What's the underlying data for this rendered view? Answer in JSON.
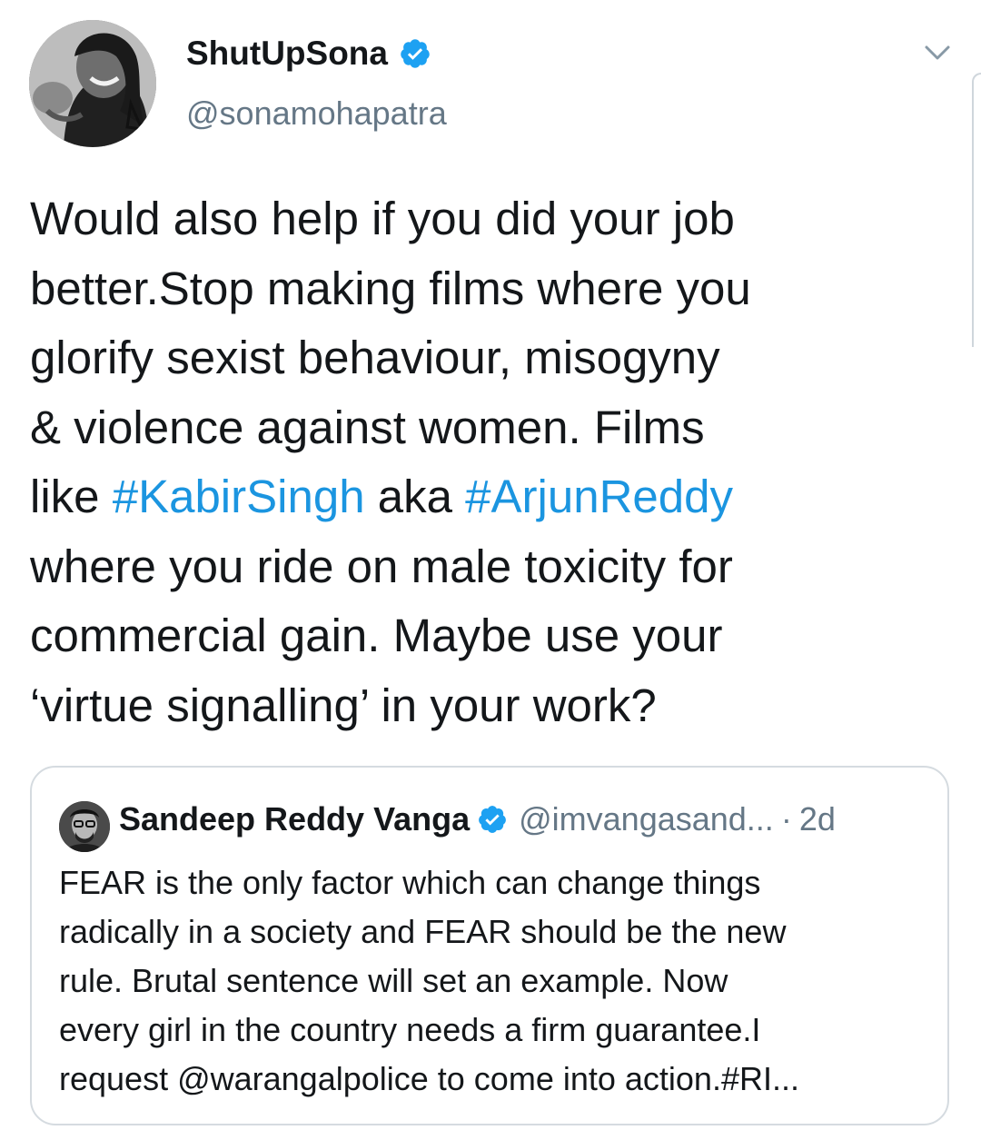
{
  "tweet": {
    "display_name": "ShutUpSona",
    "handle": "@sonamohapatra",
    "verified_icon": "verified-badge-icon",
    "menu_icon": "chevron-down-icon",
    "lines": [
      [
        {
          "text": "Would also help if you did your job",
          "hashtag": false
        }
      ],
      [
        {
          "text": "better.Stop making films where you",
          "hashtag": false
        }
      ],
      [
        {
          "text": "glorify sexist behaviour, misogyny",
          "hashtag": false
        }
      ],
      [
        {
          "text": "& violence against women. Films",
          "hashtag": false
        }
      ],
      [
        {
          "text": "like ",
          "hashtag": false
        },
        {
          "text": "#KabirSingh",
          "hashtag": true
        },
        {
          "text": " aka ",
          "hashtag": false
        },
        {
          "text": "#ArjunReddy",
          "hashtag": true
        }
      ],
      [
        {
          "text": "where you ride on male toxicity for",
          "hashtag": false
        }
      ],
      [
        {
          "text": "commercial gain. Maybe use your",
          "hashtag": false
        }
      ],
      [
        {
          "text": "‘virtue signalling’ in your work?",
          "hashtag": false
        }
      ]
    ]
  },
  "quoted_tweet": {
    "display_name": "Sandeep Reddy Vanga",
    "handle": "@imvangasand...",
    "separator": "·",
    "time": "2d",
    "lines": [
      "FEAR is the only factor which can change things",
      "radically in a society and FEAR should be the new",
      "rule. Brutal sentence will set an example. Now",
      "every girl in the country needs a firm guarantee.I",
      "request @warangalpolice to come into action.#RI..."
    ]
  },
  "colors": {
    "text": "#14171a",
    "secondary": "#657786",
    "link": "#1b95e0",
    "verified": "#1da1f2",
    "border": "#d5dbe0"
  }
}
